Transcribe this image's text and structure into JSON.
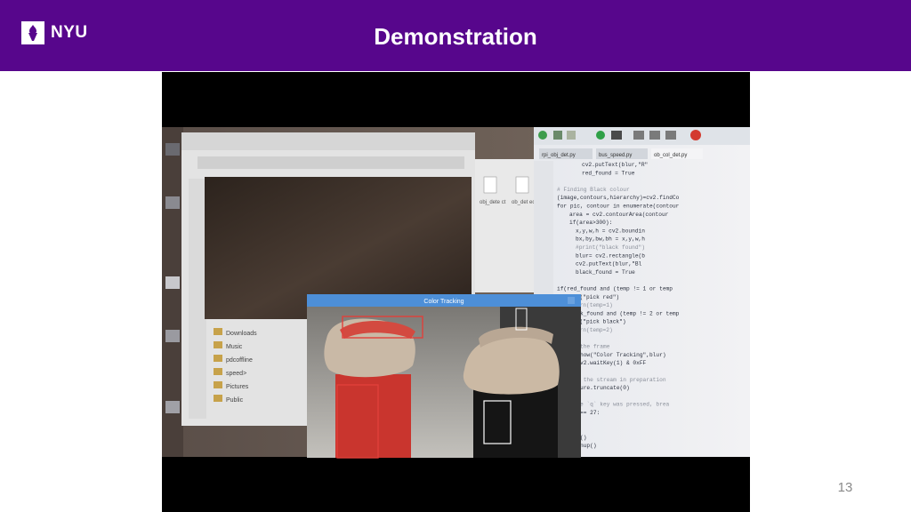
{
  "header": {
    "logo_text": "NYU",
    "title": "Demonstration",
    "background_color": "#57068c"
  },
  "video": {
    "window_title": "Color Tracking",
    "tabs": [
      "rpi_obj_det.py",
      "bus_speed.py",
      "ob_col_det.py"
    ],
    "files": [
      "obj_dete ct",
      "ob_det ect"
    ],
    "folders": [
      "Downloads",
      "Music",
      "pdcoffline",
      "speed>",
      "Pictures",
      "Public"
    ],
    "code_lines": [
      "cv2.putText(blur,\"R\"",
      "red_found = True",
      "",
      "# Finding Black colour",
      "(image,contours,hierarchy)=cv2.findCo",
      "for pic, contour in enumerate(contour",
      "area = cv2.contourArea(contour",
      "if(area>300):",
      "x,y,w,h = cv2.boundin",
      "bx,by,bw,bh = x,y,w,h",
      "#print(\"black found\")",
      "blur= cv2.rectangle(b",
      "cv2.putText(blur,\"Bl",
      "black_found = True",
      "",
      "if(red_found and (temp != 1 or temp",
      "print(\"pick red\")",
      "#return(temp=1)",
      "if(black_found and (temp != 2 or temp",
      "print(\"pick black\")",
      "#return(temp=2)",
      "",
      "# show the frame",
      "cv2.imshow(\"Color Tracking\",blur)",
      "key = cv2.waitKey(1) & 0xFF",
      "",
      "# clear the stream in preparation",
      "rawCapture.truncate(0)",
      "",
      "# if the `q` key was pressed, brea",
      "if key == 27:",
      "break",
      "",
      "am.stop()",
      "IO.cleanup()"
    ]
  },
  "page_number": "13"
}
